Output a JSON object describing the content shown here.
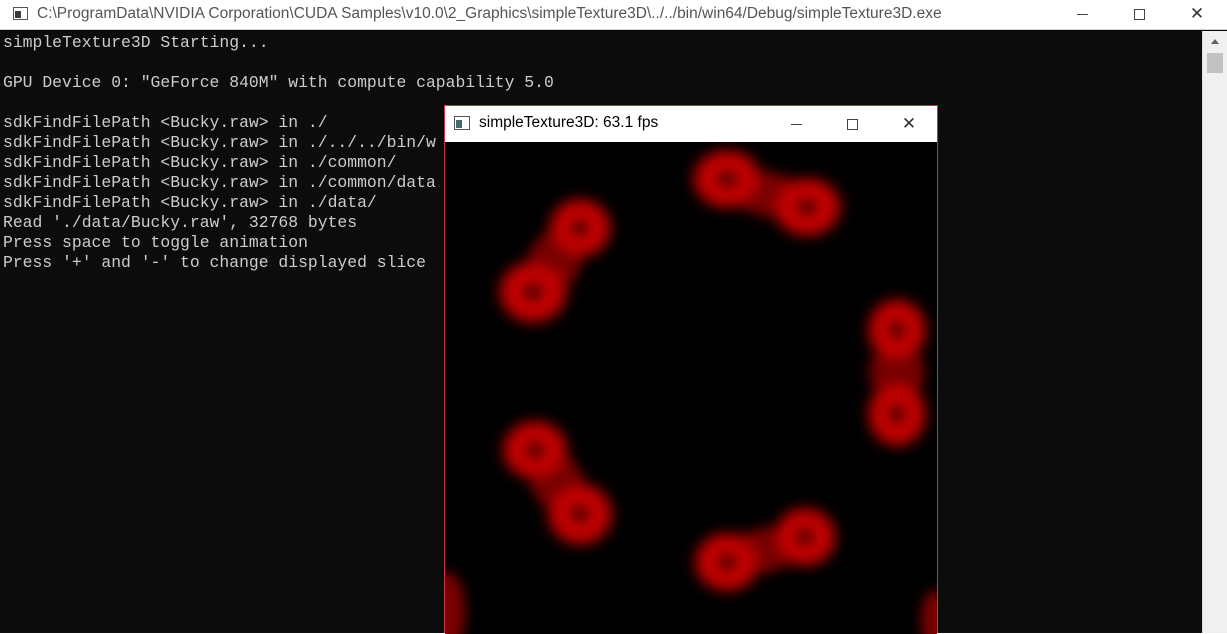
{
  "console": {
    "title": "C:\\ProgramData\\NVIDIA Corporation\\CUDA Samples\\v10.0\\2_Graphics\\simpleTexture3D\\../../bin/win64/Debug/simpleTexture3D.exe",
    "lines": [
      "simpleTexture3D Starting...",
      "",
      "GPU Device 0: \"GeForce 840M\" with compute capability 5.0",
      "",
      "sdkFindFilePath <Bucky.raw> in ./",
      "sdkFindFilePath <Bucky.raw> in ./../../bin/w",
      "sdkFindFilePath <Bucky.raw> in ./common/",
      "sdkFindFilePath <Bucky.raw> in ./common/data",
      "sdkFindFilePath <Bucky.raw> in ./data/",
      "Read './data/Bucky.raw', 32768 bytes",
      "Press space to toggle animation",
      "Press '+' and '-' to change displayed slice"
    ]
  },
  "gl_window": {
    "title": "simpleTexture3D: 63.1 fps"
  },
  "colors": {
    "console_bg": "#0c0c0c",
    "console_text": "#cccccc",
    "glow": "#ff0000"
  },
  "icons": {
    "minimize": "minimize-icon",
    "maximize": "maximize-icon",
    "close": "close-icon"
  }
}
